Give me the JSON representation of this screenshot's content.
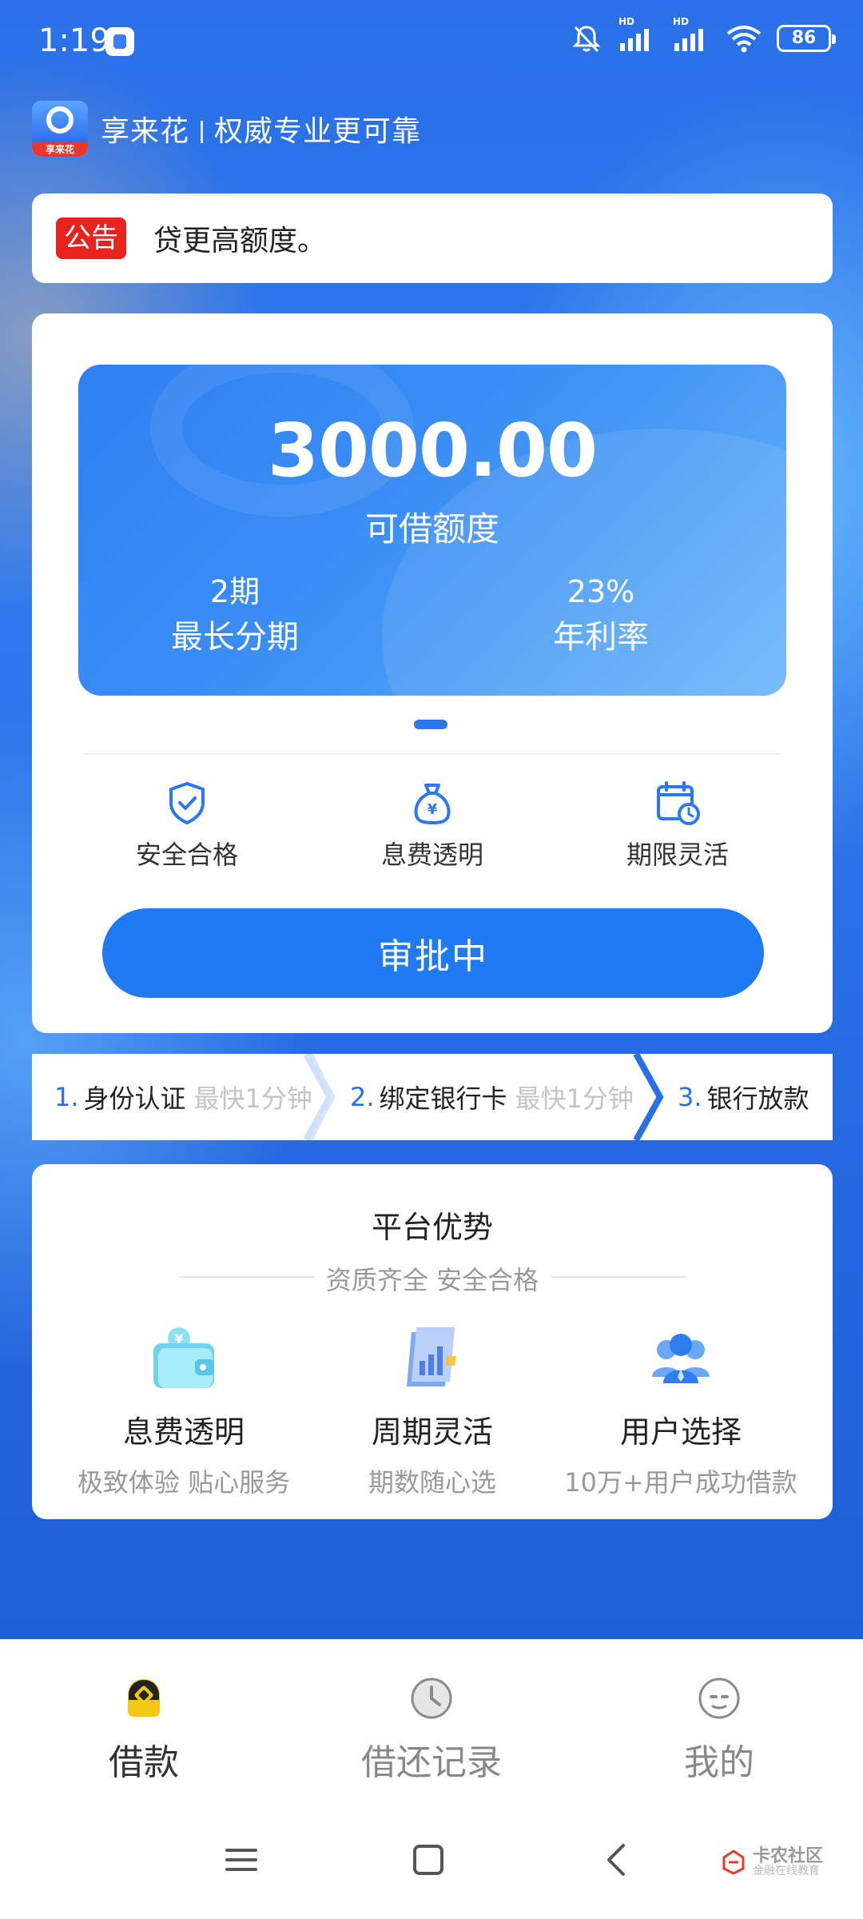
{
  "status_bar": {
    "time": "1:19",
    "signal_label_1": "HD",
    "signal_label_2": "HD",
    "battery": "86"
  },
  "header": {
    "logo_text": "享来花",
    "brand": "享来花",
    "slogan": "权威专业更可靠"
  },
  "notice": {
    "badge": "公告",
    "text": "贷更高额度。"
  },
  "quota": {
    "amount": "3000.00",
    "amount_label": "可借额度",
    "max_term_value": "2期",
    "max_term_label": "最长分期",
    "rate_value": "23%",
    "rate_label": "年利率"
  },
  "features": [
    {
      "label": "安全合格",
      "icon": "shield-check-icon"
    },
    {
      "label": "息费透明",
      "icon": "money-bag-icon"
    },
    {
      "label": "期限灵活",
      "icon": "calendar-clock-icon"
    }
  ],
  "approve_button": "审批中",
  "steps": [
    {
      "num": "1.",
      "name": "身份认证",
      "hint": "最快1分钟"
    },
    {
      "num": "2.",
      "name": "绑定银行卡",
      "hint": "最快1分钟"
    },
    {
      "num": "3.",
      "name": "银行放款",
      "hint": ""
    }
  ],
  "advantages": {
    "title": "平台优势",
    "subtitle": "资质齐全 安全合格",
    "items": [
      {
        "title": "息费透明",
        "desc": "极致体验 贴心服务",
        "icon": "wallet-icon"
      },
      {
        "title": "周期灵活",
        "desc": "期数随心选",
        "icon": "document-chart-icon"
      },
      {
        "title": "用户选择",
        "desc": "10万+用户成功借款",
        "icon": "users-icon"
      }
    ]
  },
  "bottom_nav": [
    {
      "label": "借款",
      "icon": "loan-icon",
      "active": true
    },
    {
      "label": "借还记录",
      "icon": "clock-icon",
      "active": false
    },
    {
      "label": "我的",
      "icon": "face-icon",
      "active": false
    }
  ],
  "watermark": {
    "main": "卡农社区",
    "sub": "金融在线教育"
  },
  "colors": {
    "primary": "#1f7af4",
    "notice_red": "#e8231d",
    "nav_active": "#f5c518"
  }
}
